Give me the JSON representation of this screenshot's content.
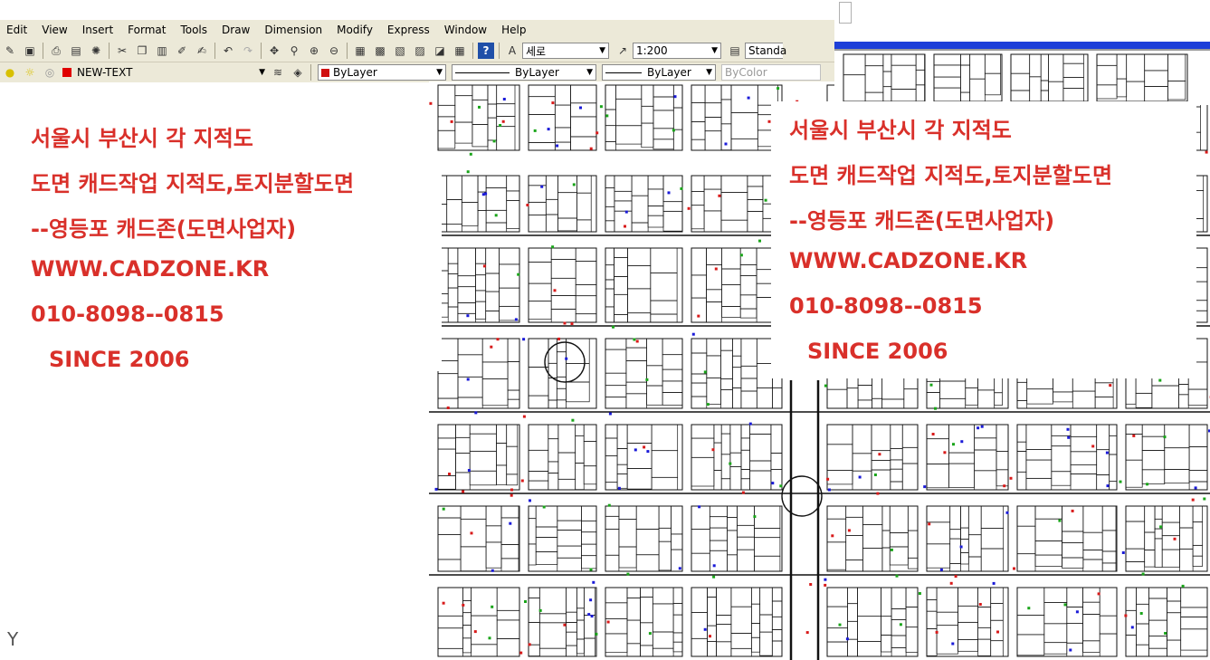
{
  "menu": [
    "Edit",
    "View",
    "Insert",
    "Format",
    "Tools",
    "Draw",
    "Dimension",
    "Modify",
    "Express",
    "Window",
    "Help"
  ],
  "toolbar": {
    "text_style": "세로",
    "dim_scale": "1:200",
    "dim_style": "Standa"
  },
  "layer_bar": {
    "layer_name": "NEW-TEXT",
    "color": "ByLayer",
    "linetype": "ByLayer",
    "lineweight": "ByLayer",
    "plotstyle": "ByColor"
  },
  "ad_left": {
    "line1": "서울시 부산시 각 지적도",
    "line2": "도면 캐드작업 지적도,토지분할도면",
    "line3": "--영등포 캐드존(도면사업자)",
    "line4": "WWW.CADZONE.KR",
    "line5": "010-8098--0815",
    "line6": "SINCE 2006"
  },
  "ad_right": {
    "line1": "서울시 부산시 각 지적도",
    "line2": "도면 캐드작업 지적도,토지분할도면",
    "line3": "--영등포 캐드존(도면사업자)",
    "line4": "WWW.CADZONE.KR",
    "line5": "010-8098--0815",
    "line6": "SINCE 2006"
  },
  "ucs_label": "Y",
  "colors": {
    "ad_text": "#d9302a",
    "toolbar_bg": "#ece9d8",
    "accent_blue": "#1d3fd8"
  }
}
